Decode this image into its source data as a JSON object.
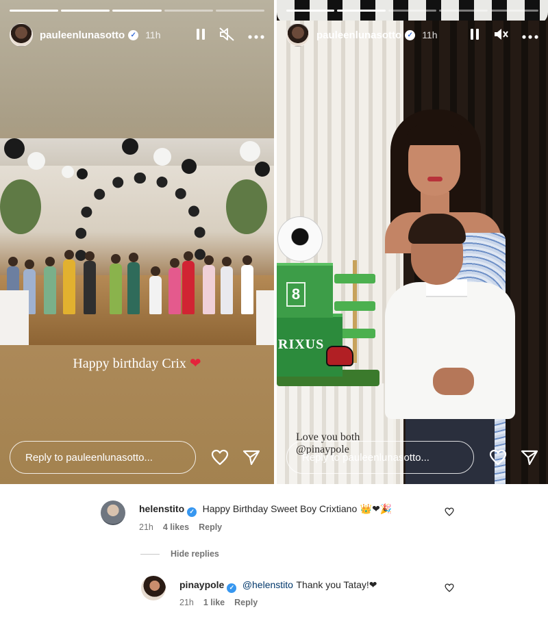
{
  "stories": [
    {
      "username": "pauleenlunasotto",
      "time": "11h",
      "progress_done": 3,
      "progress_total": 5,
      "caption": "Happy birthday Crix",
      "caption_emoji": "❤",
      "reply_placeholder": "Reply to pauleenlunasotto..."
    },
    {
      "username": "pauleenlunasotto",
      "time": "11h",
      "progress_done": 2,
      "progress_total": 5,
      "cake_name": "RIXUS",
      "cake_number": "8",
      "overlay_text_line1": "Love you both",
      "overlay_text_line2": "@pinaypole",
      "reply_placeholder": "Reply to pauleenlunasotto..."
    }
  ],
  "comments": [
    {
      "username": "helenstito",
      "text": "Happy Birthday Sweet Boy Crixtiano",
      "emojis": "👑❤🎉",
      "time": "21h",
      "likes": "4 likes",
      "reply_label": "Reply"
    }
  ],
  "hide_replies_label": "Hide replies",
  "reply": {
    "username": "pinaypole",
    "mention": "@helenstito",
    "text": "Thank you Tatay!",
    "emoji": "❤",
    "time": "21h",
    "likes": "1 like",
    "reply_label": "Reply"
  },
  "colors": {
    "heart_red": "#e4233b",
    "verified_blue": "#3797f0",
    "mention_blue": "#00376b",
    "meta_gray": "#737373"
  },
  "icons": {
    "pause": "pause-icon",
    "mute": "speaker-muted-icon",
    "more": "more-horizontal-icon",
    "like": "heart-outline-icon",
    "share": "paper-plane-icon"
  }
}
